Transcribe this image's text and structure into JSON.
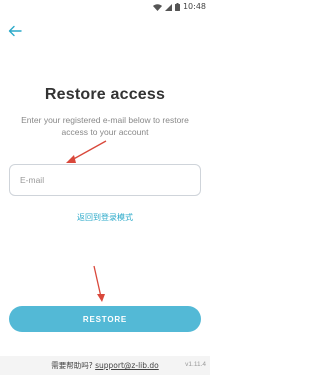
{
  "status_bar": {
    "time": "10:48",
    "icons": [
      "wifi-icon",
      "signal-icon",
      "battery-icon"
    ]
  },
  "header": {
    "back_icon": "back-arrow-icon"
  },
  "main": {
    "title": "Restore access",
    "subtitle": "Enter your registered e-mail below to restore access to your account",
    "email_field": {
      "placeholder": "E-mail",
      "value": ""
    },
    "login_link": "返回到登录模式",
    "restore_button": "RESTORE"
  },
  "footer": {
    "help_prefix": "需要帮助吗?",
    "help_email": "support@z-lib.do",
    "version": "v1.11.4"
  },
  "colors": {
    "accent": "#53b9d6",
    "link": "#2aa9c9",
    "annotation_arrow": "#d9483b"
  }
}
